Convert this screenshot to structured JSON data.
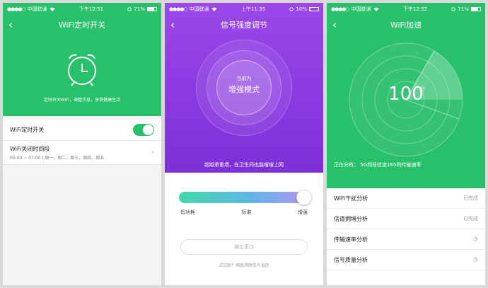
{
  "colors": {
    "green": "#29c06b",
    "purple": "#8a3ae0",
    "border": "#e6e6e6"
  },
  "panel1": {
    "status": {
      "carrier": "中国联通",
      "time": "下午12:51",
      "battery": "71%",
      "battery_level": 0.71
    },
    "title": "WiFi定时开关",
    "tagline": "定时开关WiFi，调整作息，享受健康生活",
    "row1_label": "WiFi定时开关",
    "row2_title": "WiFi关闭时间段",
    "row2_sub": "00:00 ~ 07:00 | 周一，周二，周三，周四，周五",
    "icons": {
      "back": "back-chevron-icon",
      "clock": "alarm-clock-icon",
      "arrow": "chevron-right-icon"
    }
  },
  "panel2": {
    "status": {
      "carrier": "中国联通",
      "time": "上午11:35",
      "battery": "10%",
      "battery_level": 0.1
    },
    "title": "信号强度调节",
    "mode_label": "当前为",
    "mode_value": "增强模式",
    "tip": "超越承重墙，在卫生间也能嗖嗖上网",
    "slider_value": 1.0,
    "ticks": [
      "低功耗",
      "标准",
      "增强"
    ],
    "confirm": "确定更改",
    "hint": "试试他？彻底消除信号盲区"
  },
  "panel3": {
    "status": {
      "carrier": "中国联通",
      "time": "下午12:52",
      "battery": "71%",
      "battery_level": 0.71
    },
    "title": "WiFi加速",
    "score": "100",
    "score_unit": "分",
    "analyzing": "正在分析：  5G频段信道165的传输速率",
    "items": [
      {
        "label": "WiFi干扰分析",
        "status": "已完成"
      },
      {
        "label": "信道拥堵分析",
        "status": "已完成"
      },
      {
        "label": "传输速率分析",
        "status": ""
      },
      {
        "label": "信号质量分析",
        "status": ""
      }
    ]
  }
}
